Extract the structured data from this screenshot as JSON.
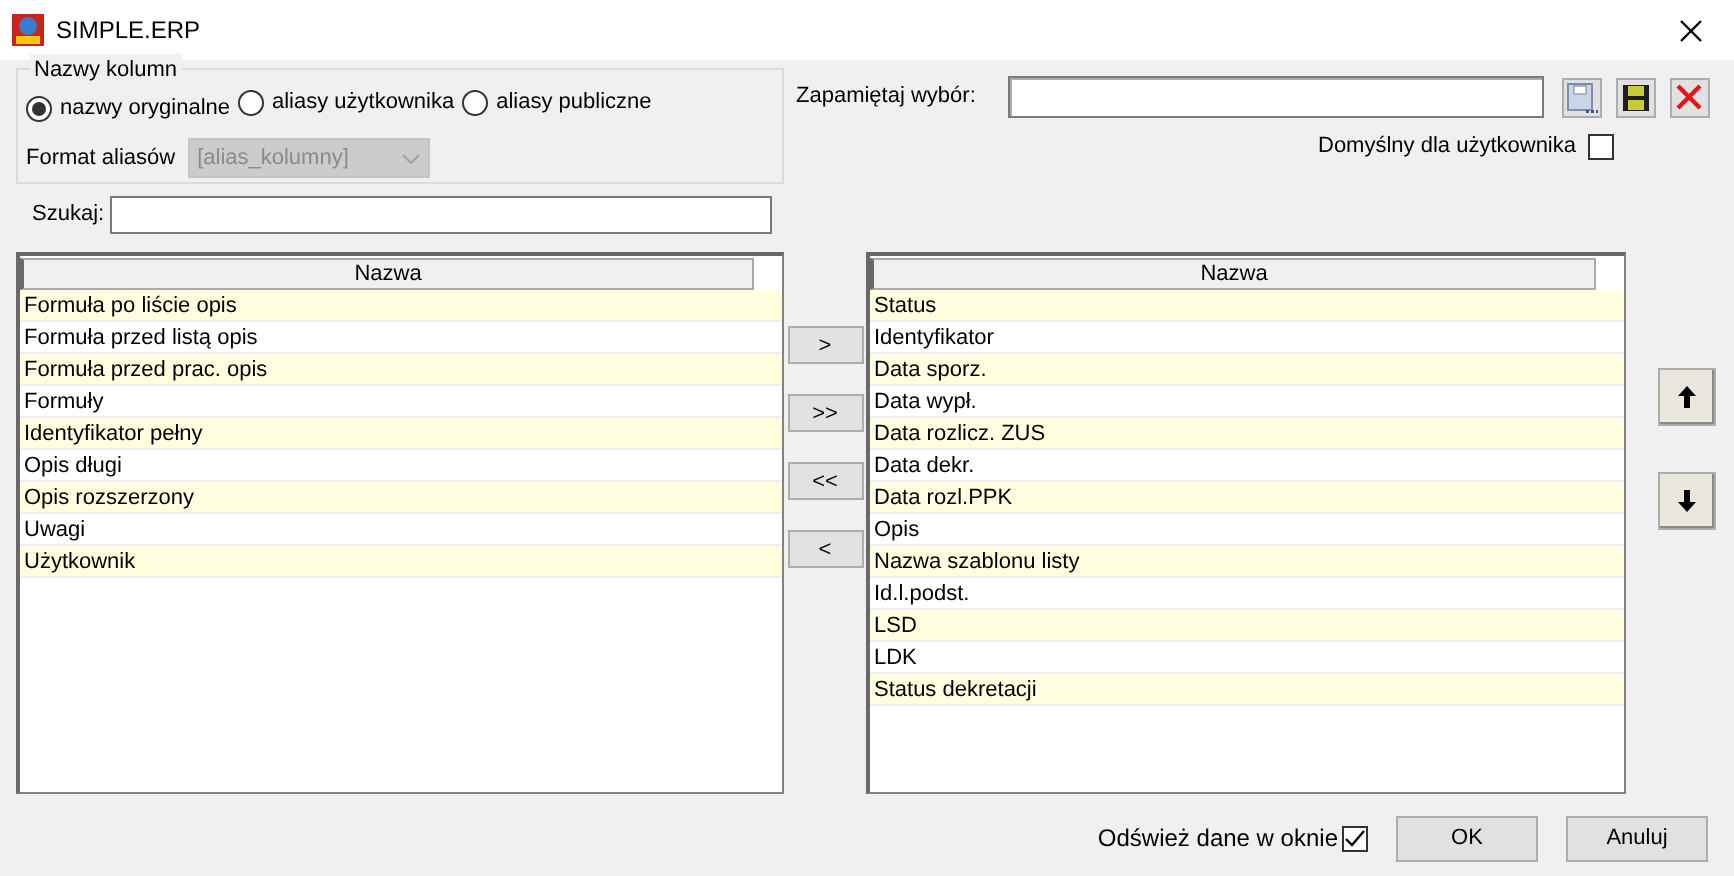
{
  "window": {
    "title": "SIMPLE.ERP"
  },
  "column_names": {
    "legend": "Nazwy kolumn",
    "options": [
      {
        "label": "nazwy oryginalne",
        "selected": true
      },
      {
        "label": "aliasy użytkownika",
        "selected": false
      },
      {
        "label": "aliasy publiczne",
        "selected": false
      }
    ],
    "alias_format": {
      "label": "Format aliasów",
      "value": "[alias_kolumny]",
      "disabled": true
    }
  },
  "search": {
    "label": "Szukaj:"
  },
  "save_choice": {
    "label": "Zapamiętaj wybór:"
  },
  "default_for_user": {
    "label": "Domyślny dla użytkownika",
    "checked": false
  },
  "available_columns": {
    "header": "Nazwa",
    "rows": [
      "Formuła po liście opis",
      "Formuła przed listą opis",
      "Formuła przed prac. opis",
      "Formuły",
      "Identyfikator pełny",
      "Opis długi",
      "Opis rozszerzony",
      "Uwagi",
      "Użytkownik"
    ]
  },
  "transfer_buttons": [
    ">",
    ">>",
    "<<",
    "<"
  ],
  "selected_columns": {
    "header": "Nazwa",
    "rows": [
      "Status",
      "Identyfikator",
      "Data sporz.",
      "Data wypł.",
      "Data rozlicz. ZUS",
      "Data dekr.",
      "Data rozl.PPK",
      "Opis",
      "Nazwa szablonu listy",
      "Id.l.podst.",
      "LSD",
      "LDK",
      "Status dekretacji"
    ]
  },
  "refresh": {
    "label": "Odśwież dane w oknie",
    "checked": true
  },
  "buttons": [
    "OK",
    "Anuluj"
  ]
}
